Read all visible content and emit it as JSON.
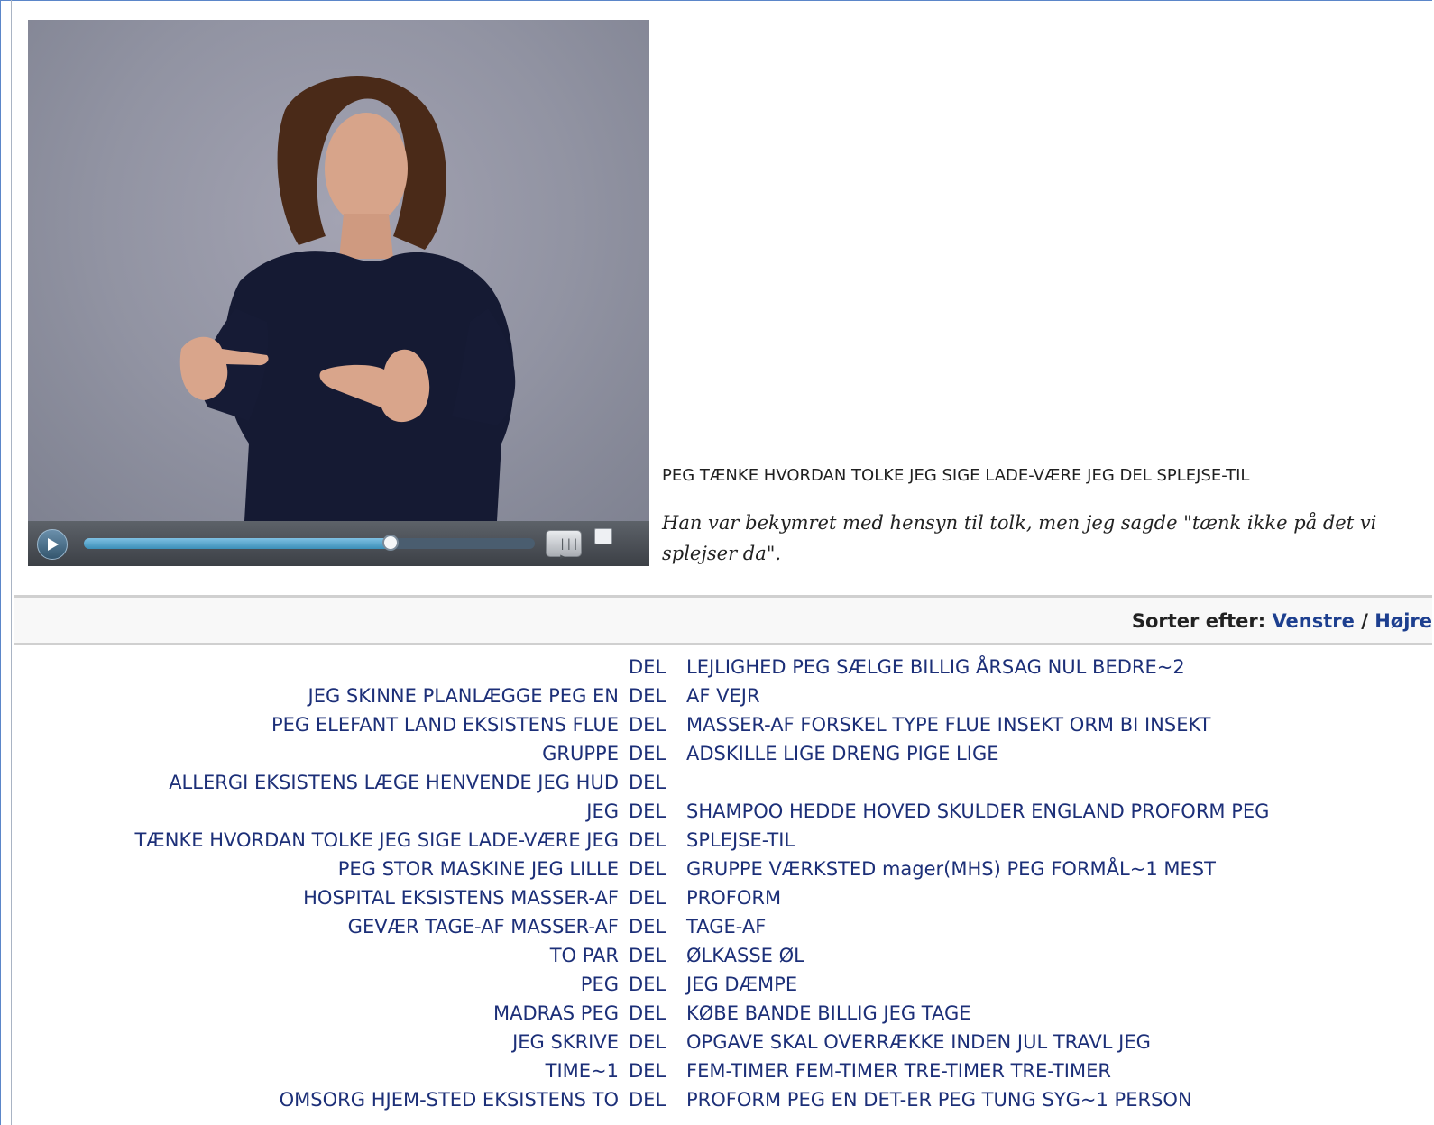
{
  "video": {
    "play_icon": "play-icon",
    "progress": 0.68,
    "volume_icon": "volume-icon",
    "volume_label": "|||▸",
    "fullscreen_icon": "fullscreen-icon"
  },
  "caption": {
    "gloss": "PEG TÆNKE HVORDAN TOLKE JEG SIGE LADE-VÆRE JEG DEL SPLEJSE-TIL",
    "translation": "Han var bekymret med hensyn til tolk, men jeg sagde \"tænk ikke på det vi splejser da\"."
  },
  "sort": {
    "label": "Sorter efter:",
    "left_link": "Venstre",
    "separator": "/",
    "right_link": "Højre"
  },
  "concordance": [
    {
      "left": "",
      "keyword": "DEL",
      "right": "LEJLIGHED PEG SÆLGE BILLIG ÅRSAG NUL BEDRE~2"
    },
    {
      "left": "JEG SKINNE PLANLÆGGE PEG EN",
      "keyword": "DEL",
      "right": "AF VEJR"
    },
    {
      "left": "PEG ELEFANT LAND EKSISTENS FLUE",
      "keyword": "DEL",
      "right": "MASSER-AF FORSKEL TYPE FLUE INSEKT ORM BI INSEKT"
    },
    {
      "left": "GRUPPE",
      "keyword": "DEL",
      "right": "ADSKILLE LIGE DRENG PIGE LIGE"
    },
    {
      "left": "ALLERGI EKSISTENS LÆGE HENVENDE JEG HUD",
      "keyword": "DEL",
      "right": ""
    },
    {
      "left": "JEG",
      "keyword": "DEL",
      "right": "SHAMPOO HEDDE HOVED SKULDER ENGLAND PROFORM PEG"
    },
    {
      "left": "TÆNKE HVORDAN TOLKE JEG SIGE LADE-VÆRE JEG",
      "keyword": "DEL",
      "right": "SPLEJSE-TIL"
    },
    {
      "left": "PEG STOR MASKINE JEG LILLE",
      "keyword": "DEL",
      "right": "GRUPPE VÆRKSTED mager(MHS) PEG FORMÅL~1 MEST"
    },
    {
      "left": "HOSPITAL EKSISTENS MASSER-AF",
      "keyword": "DEL",
      "right": "PROFORM"
    },
    {
      "left": "GEVÆR TAGE-AF MASSER-AF",
      "keyword": "DEL",
      "right": "TAGE-AF"
    },
    {
      "left": "TO PAR",
      "keyword": "DEL",
      "right": "ØLKASSE ØL"
    },
    {
      "left": "PEG",
      "keyword": "DEL",
      "right": "JEG DÆMPE"
    },
    {
      "left": "MADRAS PEG",
      "keyword": "DEL",
      "right": "KØBE BANDE BILLIG JEG TAGE"
    },
    {
      "left": "JEG SKRIVE",
      "keyword": "DEL",
      "right": "OPGAVE SKAL OVERRÆKKE INDEN JUL TRAVL JEG"
    },
    {
      "left": "TIME~1",
      "keyword": "DEL",
      "right": "FEM-TIMER FEM-TIMER TRE-TIMER TRE-TIMER"
    },
    {
      "left": "OMSORG HJEM-STED EKSISTENS TO",
      "keyword": "DEL",
      "right": "PROFORM PEG EN DET-ER PEG TUNG SYG~1 PERSON"
    }
  ]
}
